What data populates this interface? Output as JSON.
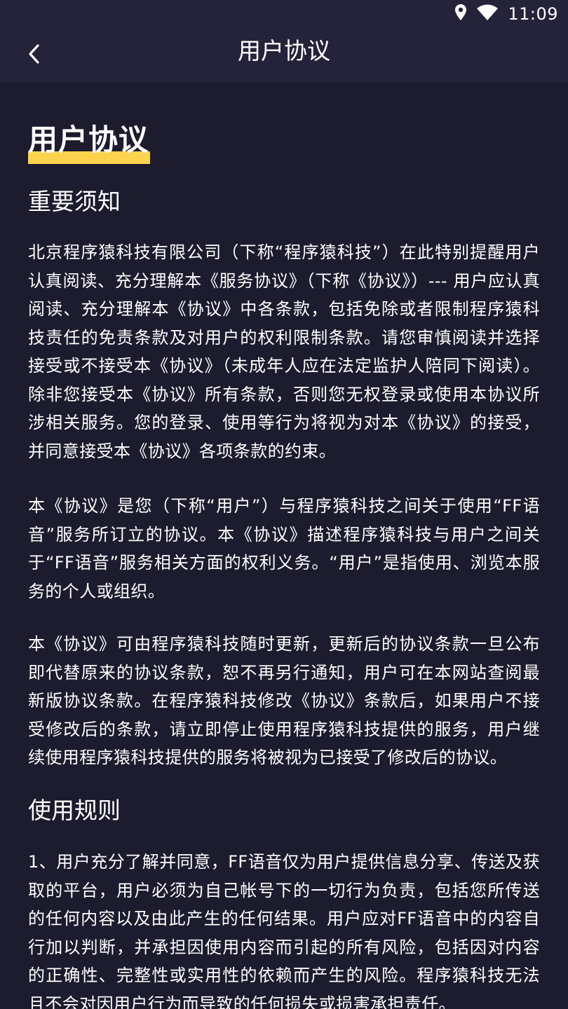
{
  "status": {
    "time": "11:09"
  },
  "nav": {
    "title": "用户协议"
  },
  "doc": {
    "title": "用户协议",
    "section1_heading": "重要须知",
    "p1": "北京程序猿科技有限公司（下称“程序猿科技”）在此特别提醒用户认真阅读、充分理解本《服务协议》（下称《协议》）--- 用户应认真阅读、充分理解本《协议》中各条款，包括免除或者限制程序猿科技责任的免责条款及对用户的权利限制条款。请您审慎阅读并选择接受或不接受本《协议》（未成年人应在法定监护人陪同下阅读）。除非您接受本《协议》所有条款，否则您无权登录或使用本协议所涉相关服务。您的登录、使用等行为将视为对本《协议》的接受，并同意接受本《协议》各项条款的约束。",
    "p2": "本《协议》是您（下称“用户”）与程序猿科技之间关于使用“FF语音”服务所订立的协议。本《协议》描述程序猿科技与用户之间关于“FF语音”服务相关方面的权利义务。“用户”是指使用、浏览本服务的个人或组织。",
    "p3": "本《协议》可由程序猿科技随时更新，更新后的协议条款一旦公布即代替原来的协议条款，恕不再另行通知，用户可在本网站查阅最新版协议条款。在程序猿科技修改《协议》条款后，如果用户不接受修改后的条款，请立即停止使用程序猿科技提供的服务，用户继续使用程序猿科技提供的服务将被视为已接受了修改后的协议。",
    "section2_heading": "使用规则",
    "p4": "1、用户充分了解并同意，FF语音仅为用户提供信息分享、传送及获取的平台，用户必须为自己帐号下的一切行为负责，包括您所传送的任何内容以及由此产生的任何结果。用户应对FF语音中的内容自行加以判断，并承担因使用内容而引起的所有风险，包括因对内容的正确性、完整性或实用性的依赖而产生的风险。程序猿科技无法且不会对因用户行为而导致的任何损失或损害承担责任。"
  },
  "colors": {
    "background": "#1d1b2e",
    "bar": "#25233a",
    "accent": "#fdd34d",
    "text": "#ffffff"
  },
  "icons": {
    "location": "location-icon",
    "wifi": "wifi-icon",
    "back": "chevron-left-icon"
  }
}
